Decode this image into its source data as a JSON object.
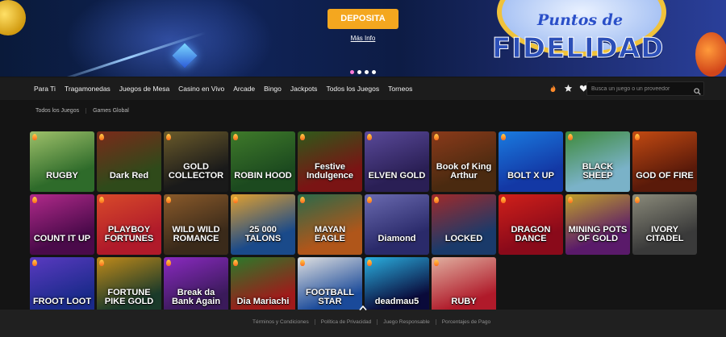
{
  "hero": {
    "cta_label": "DEPOSITA",
    "info_link": "Más Info",
    "badge_script": "Puntos de",
    "badge_main": "FIDELIDAD"
  },
  "nav": {
    "items": [
      "Para Ti",
      "Tragamonedas",
      "Juegos de Mesa",
      "Casino en Vivo",
      "Arcade",
      "Bingo",
      "Jackpots",
      "Todos los Juegos",
      "Torneos"
    ],
    "icons": [
      "flame-icon",
      "star-icon",
      "heart-icon"
    ],
    "search_placeholder": "Busca un juego o un proveedor"
  },
  "filters": [
    "Todos los Juegos",
    "Games Global"
  ],
  "games": [
    {
      "title": "RUGBY",
      "bg": "#2e6b2a",
      "bg2": "#9ec06a"
    },
    {
      "title": "Dark Red",
      "bg": "#2f4a1a",
      "bg2": "#7a2a1a"
    },
    {
      "title": "GOLD COLLECTOR",
      "bg": "#1a1a1a",
      "bg2": "#6a5a2a"
    },
    {
      "title": "ROBIN HOOD",
      "bg": "#1c4a1f",
      "bg2": "#3f7a2a"
    },
    {
      "title": "Festive Indulgence",
      "bg": "#7a1414",
      "bg2": "#2e5a1a"
    },
    {
      "title": "ELVEN GOLD",
      "bg": "#2a1f55",
      "bg2": "#5a4a9a"
    },
    {
      "title": "Book of King Arthur",
      "bg": "#4a2a10",
      "bg2": "#8a3a1a"
    },
    {
      "title": "BOLT X UP",
      "bg": "#1338a5",
      "bg2": "#1a7be0"
    },
    {
      "title": "BLACK SHEEP",
      "bg": "#7ab2c8",
      "bg2": "#3e8a3a"
    },
    {
      "title": "GOD OF FIRE",
      "bg": "#5a1a0a",
      "bg2": "#c24a12"
    },
    {
      "title": "COUNT IT UP",
      "bg": "#4a0a4a",
      "bg2": "#b02a8a"
    },
    {
      "title": "PLAYBOY FORTUNES",
      "bg": "#b01a2a",
      "bg2": "#d84a2a"
    },
    {
      "title": "WILD WILD ROMANCE",
      "bg": "#3a2a1a",
      "bg2": "#8a5a2a"
    },
    {
      "title": "25 000 TALONS",
      "bg": "#1a4a8a",
      "bg2": "#e0a030"
    },
    {
      "title": "MAYAN EAGLE",
      "bg": "#b0561a",
      "bg2": "#2a6a4a"
    },
    {
      "title": "Diamond",
      "bg": "#2a2a6a",
      "bg2": "#6a6ab0"
    },
    {
      "title": "LOCKED",
      "bg": "#1a3a6a",
      "bg2": "#a02a2a"
    },
    {
      "title": "DRAGON DANCE",
      "bg": "#8a0a1a",
      "bg2": "#d0201a"
    },
    {
      "title": "MINING POTS OF GOLD",
      "bg": "#5a1a6a",
      "bg2": "#c0a02a"
    },
    {
      "title": "IVORY CITADEL",
      "bg": "#3a3a3a",
      "bg2": "#8a8a7a"
    },
    {
      "title": "FROOT LOOT",
      "bg": "#1a2a8a",
      "bg2": "#5a3ac0"
    },
    {
      "title": "FORTUNE PIKE GOLD",
      "bg": "#1a3a2a",
      "bg2": "#c08a1a"
    },
    {
      "title": "Break da Bank Again",
      "bg": "#3a1a5a",
      "bg2": "#8a2ac0"
    },
    {
      "title": "Dia Mariachi",
      "bg": "#a01a1a",
      "bg2": "#2a7a2a"
    },
    {
      "title": "FOOTBALL STAR",
      "bg": "#1a4a9a",
      "bg2": "#e0e0e0"
    },
    {
      "title": "deadmau5",
      "bg": "#0a0a3a",
      "bg2": "#2ab0e0"
    },
    {
      "title": "RUBY",
      "bg": "#b01a2a",
      "bg2": "#e0b0a0"
    }
  ],
  "footer": {
    "links": [
      "Términos y Condiciones",
      "Política de Privacidad",
      "Juego Responsable",
      "Porcentajes de Pago"
    ]
  }
}
